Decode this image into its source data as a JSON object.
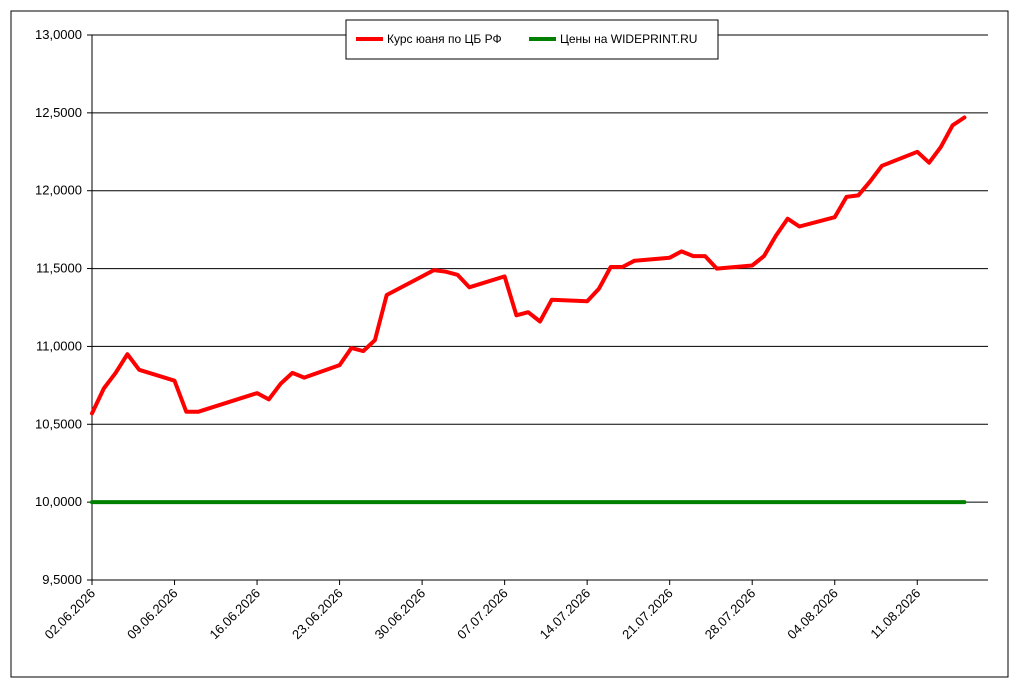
{
  "chart_data": {
    "type": "line",
    "title": "",
    "xlabel": "",
    "ylabel": "",
    "ylim": [
      9.5,
      13.0
    ],
    "yticks": [
      "9,5000",
      "10,0000",
      "10,5000",
      "11,0000",
      "11,5000",
      "12,0000",
      "12,5000",
      "13,0000"
    ],
    "xlim": [
      "2026-06-02",
      "2026-08-17"
    ],
    "xticks": [
      {
        "date": "2026-06-02",
        "label": "02.06.2026"
      },
      {
        "date": "2026-06-09",
        "label": "09.06.2026"
      },
      {
        "date": "2026-06-16",
        "label": "16.06.2026"
      },
      {
        "date": "2026-06-23",
        "label": "23.06.2026"
      },
      {
        "date": "2026-06-30",
        "label": "30.06.2026"
      },
      {
        "date": "2026-07-07",
        "label": "07.07.2026"
      },
      {
        "date": "2026-07-14",
        "label": "14.07.2026"
      },
      {
        "date": "2026-07-21",
        "label": "21.07.2026"
      },
      {
        "date": "2026-07-28",
        "label": "28.07.2026"
      },
      {
        "date": "2026-08-04",
        "label": "04.08.2026"
      },
      {
        "date": "2026-08-11",
        "label": "11.08.2026"
      }
    ],
    "grid": true,
    "legend_position": "top-center",
    "series": [
      {
        "name": "Курс юаня по ЦБ РФ",
        "color": "#ff0000",
        "points": [
          [
            "2026-06-02",
            10.57
          ],
          [
            "2026-06-03",
            10.73
          ],
          [
            "2026-06-04",
            10.83
          ],
          [
            "2026-06-05",
            10.95
          ],
          [
            "2026-06-06",
            10.85
          ],
          [
            "2026-06-09",
            10.78
          ],
          [
            "2026-06-10",
            10.58
          ],
          [
            "2026-06-11",
            10.58
          ],
          [
            "2026-06-16",
            10.7
          ],
          [
            "2026-06-17",
            10.66
          ],
          [
            "2026-06-18",
            10.76
          ],
          [
            "2026-06-19",
            10.83
          ],
          [
            "2026-06-20",
            10.8
          ],
          [
            "2026-06-23",
            10.88
          ],
          [
            "2026-06-24",
            10.99
          ],
          [
            "2026-06-25",
            10.97
          ],
          [
            "2026-06-26",
            11.04
          ],
          [
            "2026-06-27",
            11.33
          ],
          [
            "2026-06-30",
            11.45
          ],
          [
            "2026-07-01",
            11.49
          ],
          [
            "2026-07-02",
            11.48
          ],
          [
            "2026-07-03",
            11.46
          ],
          [
            "2026-07-04",
            11.38
          ],
          [
            "2026-07-07",
            11.45
          ],
          [
            "2026-07-08",
            11.2
          ],
          [
            "2026-07-09",
            11.22
          ],
          [
            "2026-07-10",
            11.16
          ],
          [
            "2026-07-11",
            11.3
          ],
          [
            "2026-07-14",
            11.29
          ],
          [
            "2026-07-15",
            11.37
          ],
          [
            "2026-07-16",
            11.51
          ],
          [
            "2026-07-17",
            11.51
          ],
          [
            "2026-07-18",
            11.55
          ],
          [
            "2026-07-21",
            11.57
          ],
          [
            "2026-07-22",
            11.61
          ],
          [
            "2026-07-23",
            11.58
          ],
          [
            "2026-07-24",
            11.58
          ],
          [
            "2026-07-25",
            11.5
          ],
          [
            "2026-07-28",
            11.52
          ],
          [
            "2026-07-29",
            11.58
          ],
          [
            "2026-07-30",
            11.71
          ],
          [
            "2026-07-31",
            11.82
          ],
          [
            "2026-08-01",
            11.77
          ],
          [
            "2026-08-04",
            11.83
          ],
          [
            "2026-08-05",
            11.96
          ],
          [
            "2026-08-06",
            11.97
          ],
          [
            "2026-08-07",
            12.06
          ],
          [
            "2026-08-08",
            12.16
          ],
          [
            "2026-08-11",
            12.25
          ],
          [
            "2026-08-12",
            12.18
          ],
          [
            "2026-08-13",
            12.28
          ],
          [
            "2026-08-14",
            12.42
          ],
          [
            "2026-08-15",
            12.47
          ]
        ]
      },
      {
        "name": "Цены на WIDEPRINT.RU",
        "color": "#008000",
        "points": [
          [
            "2026-06-02",
            10.0
          ],
          [
            "2026-08-15",
            10.0
          ]
        ]
      }
    ]
  }
}
